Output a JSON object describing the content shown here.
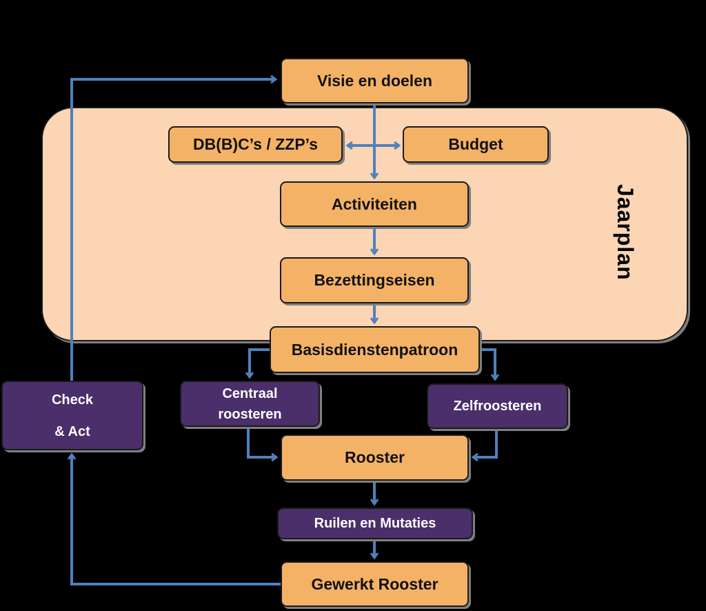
{
  "colors": {
    "process": "#F4B266",
    "step": "#4A2F6A",
    "container": "#FCD5B5",
    "arrow": "#4F81BD",
    "background": "#000000"
  },
  "container": {
    "label": "Jaarplan"
  },
  "nodes": {
    "visie": "Visie en doelen",
    "dbbc": "DB(B)C’s / ZZP’s",
    "budget": "Budget",
    "activiteiten": "Activiteiten",
    "bezetting": "Bezettingseisen",
    "basis": "Basisdienstenpatroon",
    "check_line1": "Check",
    "check_line2": "& Act",
    "centraal_line1": "Centraal",
    "centraal_line2": "roosteren",
    "zelf": "Zelfroosteren",
    "rooster": "Rooster",
    "ruilen": "Ruilen en Mutaties",
    "gewerkt": "Gewerkt Rooster"
  }
}
